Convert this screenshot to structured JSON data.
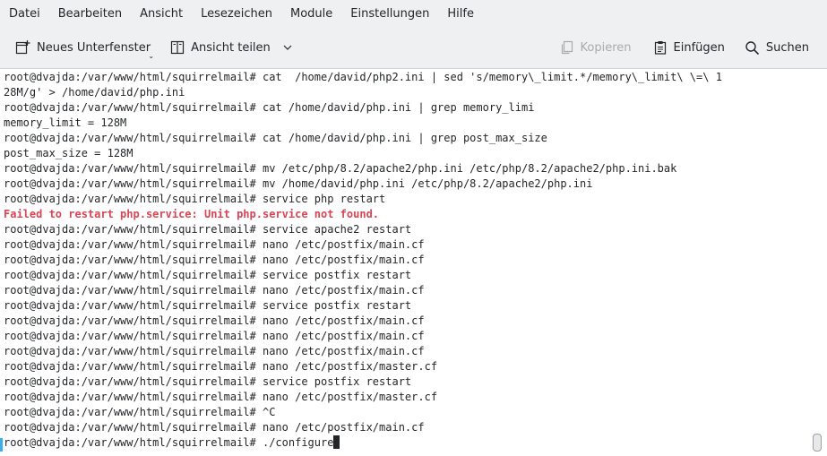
{
  "menubar": {
    "items": [
      "Datei",
      "Bearbeiten",
      "Ansicht",
      "Lesezeichen",
      "Module",
      "Einstellungen",
      "Hilfe"
    ]
  },
  "toolbar": {
    "new_tab_label": "Neues Unterfenster",
    "split_view_label": "Ansicht teilen",
    "copy_label": "Kopieren",
    "paste_label": "Einfügen",
    "search_label": "Suchen"
  },
  "terminal": {
    "lines": [
      "root@dvajda:/var/www/html/squirrelmail# cat  /home/david/php2.ini | sed 's/memory\\_limit.*/memory\\_limit\\ \\=\\ 1",
      "28M/g' > /home/david/php.ini",
      "root@dvajda:/var/www/html/squirrelmail# cat /home/david/php.ini | grep memory_limi",
      "memory_limit = 128M",
      "root@dvajda:/var/www/html/squirrelmail# cat /home/david/php.ini | grep post_max_size",
      "post_max_size = 128M",
      "root@dvajda:/var/www/html/squirrelmail# mv /etc/php/8.2/apache2/php.ini /etc/php/8.2/apache2/php.ini.bak",
      "root@dvajda:/var/www/html/squirrelmail# mv /home/david/php.ini /etc/php/8.2/apache2/php.ini",
      "root@dvajda:/var/www/html/squirrelmail# service php restart",
      "Failed to restart php.service: Unit php.service not found.",
      "root@dvajda:/var/www/html/squirrelmail# service apache2 restart",
      "root@dvajda:/var/www/html/squirrelmail# nano /etc/postfix/main.cf",
      "root@dvajda:/var/www/html/squirrelmail# nano /etc/postfix/main.cf",
      "root@dvajda:/var/www/html/squirrelmail# service postfix restart",
      "root@dvajda:/var/www/html/squirrelmail# nano /etc/postfix/main.cf",
      "root@dvajda:/var/www/html/squirrelmail# service postfix restart",
      "root@dvajda:/var/www/html/squirrelmail# nano /etc/postfix/main.cf",
      "root@dvajda:/var/www/html/squirrelmail# nano /etc/postfix/main.cf",
      "root@dvajda:/var/www/html/squirrelmail# nano /etc/postfix/main.cf",
      "root@dvajda:/var/www/html/squirrelmail# nano /etc/postfix/master.cf",
      "root@dvajda:/var/www/html/squirrelmail# service postfix restart",
      "root@dvajda:/var/www/html/squirrelmail# nano /etc/postfix/master.cf",
      "root@dvajda:/var/www/html/squirrelmail# ^C",
      "root@dvajda:/var/www/html/squirrelmail# nano /etc/postfix/main.cf",
      "root@dvajda:/var/www/html/squirrelmail# ./configure"
    ],
    "error_line_index": 9
  },
  "icons": {
    "new_tab": "new-tab-icon",
    "split_view": "split-view-icon",
    "split_dropdown": "chevron-down-icon",
    "copy": "copy-icon",
    "paste": "paste-icon",
    "search": "search-icon"
  },
  "colors": {
    "error": "#da4453",
    "text": "#232629",
    "disabled": "#a8aaac",
    "accent": "#3daee9"
  }
}
